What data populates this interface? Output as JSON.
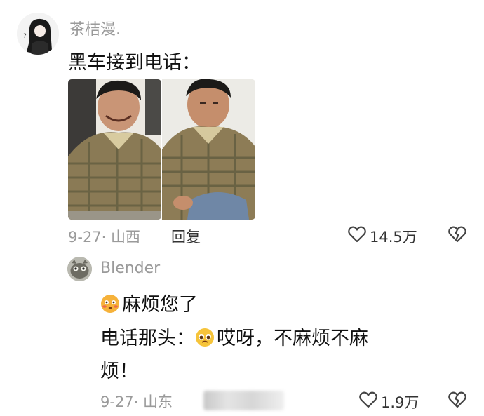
{
  "comment": {
    "username": "茶桔漫.",
    "text": "黑车接到电话：",
    "date": "9-27",
    "location": "山西",
    "reply_label": "回复",
    "like_count": "14.5万",
    "like_icon": "heart-outline",
    "dislike_icon": "broken-heart-outline"
  },
  "reply": {
    "username": "Blender",
    "line1": "麻烦您了",
    "line2_prefix": "电话那头：",
    "line2_suffix": "哎呀，不麻烦不麻",
    "line3": "烦！",
    "emoji1": "flushed-face",
    "emoji2": "pleading-face",
    "date": "9-27",
    "location": "山东",
    "like_count": "1.9万",
    "like_icon": "heart-outline",
    "dislike_icon": "broken-heart-outline"
  },
  "colors": {
    "meta_gray": "#9a9a9a",
    "text_dark": "#111111",
    "icon_gray": "#4a4a4a"
  }
}
